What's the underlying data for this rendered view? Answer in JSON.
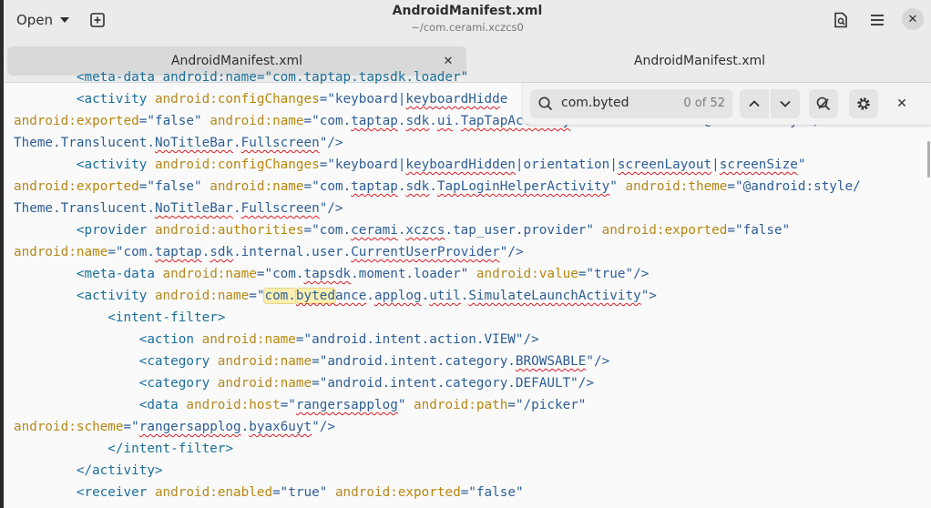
{
  "header": {
    "open_label": "Open",
    "title": "AndroidManifest.xml",
    "subtitle": "~/com.cerami.xczcs0"
  },
  "tabs": [
    {
      "label": "AndroidManifest.xml",
      "active": true
    },
    {
      "label": "AndroidManifest.xml",
      "active": false
    }
  ],
  "search": {
    "value": "com.byted",
    "match_count": "0 of 52"
  },
  "icons": {
    "new_tab": "new-tab-icon",
    "document": "document-search-icon",
    "menu": "hamburger-menu-icon",
    "close": "close-icon",
    "search": "search-icon",
    "prev": "chevron-up-icon",
    "next": "chevron-down-icon",
    "replace": "find-replace-icon",
    "settings": "gear-icon"
  },
  "colors": {
    "tag": "#1a6f9a",
    "attribute": "#b8860b",
    "value": "#2d5e95",
    "highlight": "#fcefb2",
    "spell_error": "#e01b24"
  },
  "code_lines": [
    [
      {
        "t": "        <meta-data android:name=\"com.taptap.tapsdk.loader\"",
        "c": "tg"
      }
    ],
    [
      {
        "t": "        <activity ",
        "c": "tg"
      },
      {
        "t": "android:",
        "c": "ns"
      },
      {
        "t": "configChanges",
        "c": "at"
      },
      {
        "t": "=\"keyboard|",
        "c": "vl"
      },
      {
        "t": "keyboardHidd",
        "c": "vl",
        "s": 1
      },
      {
        "t": "e",
        "c": "vl"
      }
    ],
    [
      {
        "t": "android:",
        "c": "ns"
      },
      {
        "t": "exported",
        "c": "at"
      },
      {
        "t": "=\"false\" ",
        "c": "vl"
      },
      {
        "t": "android:",
        "c": "ns"
      },
      {
        "t": "name",
        "c": "at"
      },
      {
        "t": "=\"com.",
        "c": "vl"
      },
      {
        "t": "taptap",
        "c": "vl",
        "s": 1
      },
      {
        "t": ".",
        "c": "vl"
      },
      {
        "t": "sdk",
        "c": "vl",
        "s": 1
      },
      {
        "t": ".",
        "c": "vl"
      },
      {
        "t": "ui",
        "c": "vl",
        "s": 1
      },
      {
        "t": ".",
        "c": "vl"
      },
      {
        "t": "TapTapActivity",
        "c": "vl",
        "s": 1
      },
      {
        "t": "\" ",
        "c": "vl"
      },
      {
        "t": "android:",
        "c": "ns"
      },
      {
        "t": "theme",
        "c": "at"
      },
      {
        "t": "=\"@android:style/",
        "c": "vl"
      }
    ],
    [
      {
        "t": "Theme.Translucent.",
        "c": "vl"
      },
      {
        "t": "NoTitleBar",
        "c": "vl",
        "s": 1
      },
      {
        "t": ".",
        "c": "vl"
      },
      {
        "t": "Fullscreen",
        "c": "vl",
        "s": 1
      },
      {
        "t": "\"/>",
        "c": "vl"
      }
    ],
    [
      {
        "t": "        <activity ",
        "c": "tg"
      },
      {
        "t": "android:",
        "c": "ns"
      },
      {
        "t": "configChanges",
        "c": "at"
      },
      {
        "t": "=\"keyboard|",
        "c": "vl"
      },
      {
        "t": "keyboardHidden",
        "c": "vl",
        "s": 1
      },
      {
        "t": "|orientation|",
        "c": "vl"
      },
      {
        "t": "screenLayout",
        "c": "vl",
        "s": 1
      },
      {
        "t": "|",
        "c": "vl"
      },
      {
        "t": "screenSize",
        "c": "vl",
        "s": 1
      },
      {
        "t": "\"",
        "c": "vl"
      }
    ],
    [
      {
        "t": "android:",
        "c": "ns"
      },
      {
        "t": "exported",
        "c": "at"
      },
      {
        "t": "=\"false\" ",
        "c": "vl"
      },
      {
        "t": "android:",
        "c": "ns"
      },
      {
        "t": "name",
        "c": "at"
      },
      {
        "t": "=\"com.",
        "c": "vl"
      },
      {
        "t": "taptap",
        "c": "vl",
        "s": 1
      },
      {
        "t": ".",
        "c": "vl"
      },
      {
        "t": "sdk",
        "c": "vl",
        "s": 1
      },
      {
        "t": ".",
        "c": "vl"
      },
      {
        "t": "TapLoginHelperActivity",
        "c": "vl",
        "s": 1
      },
      {
        "t": "\" ",
        "c": "vl"
      },
      {
        "t": "android:",
        "c": "ns"
      },
      {
        "t": "theme",
        "c": "at"
      },
      {
        "t": "=\"@android:style/",
        "c": "vl"
      }
    ],
    [
      {
        "t": "Theme.Translucent.",
        "c": "vl"
      },
      {
        "t": "NoTitleBar",
        "c": "vl",
        "s": 1
      },
      {
        "t": ".",
        "c": "vl"
      },
      {
        "t": "Fullscreen",
        "c": "vl",
        "s": 1
      },
      {
        "t": "\"/>",
        "c": "vl"
      }
    ],
    [
      {
        "t": "        <provider ",
        "c": "tg"
      },
      {
        "t": "android:",
        "c": "ns"
      },
      {
        "t": "authorities",
        "c": "at"
      },
      {
        "t": "=\"com.",
        "c": "vl"
      },
      {
        "t": "cerami",
        "c": "vl",
        "s": 1
      },
      {
        "t": ".",
        "c": "vl"
      },
      {
        "t": "xczcs",
        "c": "vl",
        "s": 1
      },
      {
        "t": ".tap_user.provider\" ",
        "c": "vl"
      },
      {
        "t": "android:",
        "c": "ns"
      },
      {
        "t": "exported",
        "c": "at"
      },
      {
        "t": "=\"false\"",
        "c": "vl"
      }
    ],
    [
      {
        "t": "android:",
        "c": "ns"
      },
      {
        "t": "name",
        "c": "at"
      },
      {
        "t": "=\"com.",
        "c": "vl"
      },
      {
        "t": "taptap",
        "c": "vl",
        "s": 1
      },
      {
        "t": ".",
        "c": "vl"
      },
      {
        "t": "sdk",
        "c": "vl",
        "s": 1
      },
      {
        "t": ".internal.user.",
        "c": "vl"
      },
      {
        "t": "CurrentUserProvider",
        "c": "vl",
        "s": 1
      },
      {
        "t": "\"/>",
        "c": "vl"
      }
    ],
    [
      {
        "t": "        <meta-data ",
        "c": "tg"
      },
      {
        "t": "android:",
        "c": "ns"
      },
      {
        "t": "name",
        "c": "at"
      },
      {
        "t": "=\"com.",
        "c": "vl"
      },
      {
        "t": "tapsdk",
        "c": "vl",
        "s": 1
      },
      {
        "t": ".moment.loader\" ",
        "c": "vl"
      },
      {
        "t": "android:",
        "c": "ns"
      },
      {
        "t": "value",
        "c": "at"
      },
      {
        "t": "=\"true\"/>",
        "c": "vl"
      }
    ],
    [
      {
        "t": "        <activity ",
        "c": "tg"
      },
      {
        "t": "android:",
        "c": "ns"
      },
      {
        "t": "name",
        "c": "at"
      },
      {
        "t": "=\"",
        "c": "vl"
      },
      {
        "t": "com.",
        "c": "vl",
        "h": 1
      },
      {
        "t": "byted",
        "c": "vl",
        "h": 1,
        "s": 1
      },
      {
        "t": "ance",
        "c": "vl",
        "s": 1
      },
      {
        "t": ".",
        "c": "vl"
      },
      {
        "t": "applog",
        "c": "vl",
        "s": 1
      },
      {
        "t": ".",
        "c": "vl"
      },
      {
        "t": "util",
        "c": "vl",
        "s": 1
      },
      {
        "t": ".",
        "c": "vl"
      },
      {
        "t": "SimulateLaunchActivity",
        "c": "vl",
        "s": 1
      },
      {
        "t": "\">",
        "c": "vl"
      }
    ],
    [
      {
        "t": "            <intent-filter>",
        "c": "tg"
      }
    ],
    [
      {
        "t": "                <action ",
        "c": "tg"
      },
      {
        "t": "android:",
        "c": "ns"
      },
      {
        "t": "name",
        "c": "at"
      },
      {
        "t": "=\"android.intent.action.VIEW\"/>",
        "c": "vl"
      }
    ],
    [
      {
        "t": "                <category ",
        "c": "tg"
      },
      {
        "t": "android:",
        "c": "ns"
      },
      {
        "t": "name",
        "c": "at"
      },
      {
        "t": "=\"android.intent.category.",
        "c": "vl"
      },
      {
        "t": "BROWSABLE",
        "c": "vl",
        "s": 1
      },
      {
        "t": "\"/>",
        "c": "vl"
      }
    ],
    [
      {
        "t": "                <category ",
        "c": "tg"
      },
      {
        "t": "android:",
        "c": "ns"
      },
      {
        "t": "name",
        "c": "at"
      },
      {
        "t": "=\"android.intent.category.DEFAULT\"/>",
        "c": "vl"
      }
    ],
    [
      {
        "t": "                <data ",
        "c": "tg"
      },
      {
        "t": "android:",
        "c": "ns"
      },
      {
        "t": "host",
        "c": "at"
      },
      {
        "t": "=\"",
        "c": "vl"
      },
      {
        "t": "rangersapplog",
        "c": "vl",
        "s": 1
      },
      {
        "t": "\" ",
        "c": "vl"
      },
      {
        "t": "android:",
        "c": "ns"
      },
      {
        "t": "path",
        "c": "at"
      },
      {
        "t": "=\"/picker\"",
        "c": "vl"
      }
    ],
    [
      {
        "t": "android:",
        "c": "ns"
      },
      {
        "t": "scheme",
        "c": "at"
      },
      {
        "t": "=\"",
        "c": "vl"
      },
      {
        "t": "rangersapplog",
        "c": "vl",
        "s": 1
      },
      {
        "t": ".",
        "c": "vl"
      },
      {
        "t": "byax6uyt",
        "c": "vl",
        "s": 1
      },
      {
        "t": "\"/>",
        "c": "vl"
      }
    ],
    [
      {
        "t": "            </intent-filter>",
        "c": "tg"
      }
    ],
    [
      {
        "t": "        </activity>",
        "c": "tg"
      }
    ],
    [
      {
        "t": "        <receiver ",
        "c": "tg"
      },
      {
        "t": "android:",
        "c": "ns"
      },
      {
        "t": "enabled",
        "c": "at"
      },
      {
        "t": "=\"true\" ",
        "c": "vl"
      },
      {
        "t": "android:",
        "c": "ns"
      },
      {
        "t": "exported",
        "c": "at"
      },
      {
        "t": "=\"false\"",
        "c": "vl"
      }
    ]
  ]
}
